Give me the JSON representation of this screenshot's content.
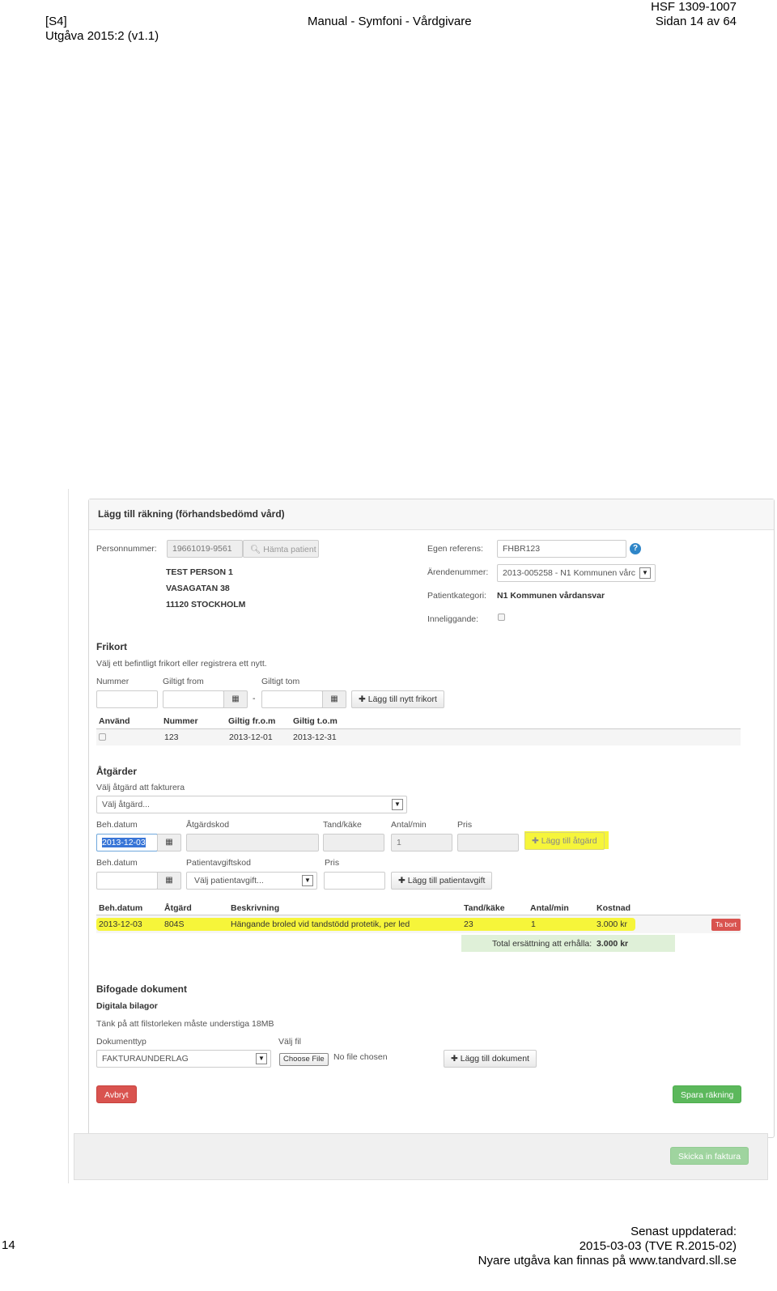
{
  "header": {
    "code": "[S4]",
    "edition": "Utgåva 2015:2 (v1.1)",
    "title": "Manual - Symfoni - Vårdgivare",
    "doc_id": "HSF 1309-1007",
    "page_of": "Sidan 14 av 64"
  },
  "footer": {
    "page_number": "14",
    "updated_label": "Senast uppdaterad:",
    "updated_value": "2015-03-03 (TVE R.2015-02)",
    "newer_note": "Nyare utgåva kan finnas på www.tandvard.sll.se"
  },
  "form": {
    "title": "Lägg till räkning (förhandsbedömd vård)",
    "patient": {
      "personnummer_label": "Personnummer:",
      "personnummer_value": "19661019-9561",
      "fetch_button": "Hämta patient",
      "name": "TEST PERSON 1",
      "street": "VASAGATAN 38",
      "city": "11120 STOCKHOLM"
    },
    "reference": {
      "egen_label": "Egen referens:",
      "egen_value": "FHBR123",
      "arende_label": "Ärendenummer:",
      "arende_value": "2013-005258 - N1 Kommunen vårc",
      "kategori_label": "Patientkategori:",
      "kategori_value": "N1 Kommunen vårdansvar",
      "inneliggande_label": "Inneliggande:"
    },
    "frikort": {
      "heading": "Frikort",
      "hint": "Välj ett befintligt frikort eller registrera ett nytt.",
      "nummer_label": "Nummer",
      "from_label": "Giltigt from",
      "tom_label": "Giltigt tom",
      "dash": "-",
      "add_button": "Lägg till nytt frikort",
      "table_headers": [
        "Använd",
        "Nummer",
        "Giltig fr.o.m",
        "Giltig t.o.m"
      ],
      "rows": [
        {
          "nummer": "123",
          "from": "2013-12-01",
          "tom": "2013-12-31"
        }
      ]
    },
    "atgarder": {
      "heading": "Åtgärder",
      "hint": "Välj åtgärd att fakturera",
      "select_placeholder": "Välj åtgärd...",
      "beh_datum_label": "Beh.datum",
      "atgardskod_label": "Åtgärdskod",
      "tand_label": "Tand/käke",
      "antal_label": "Antal/min",
      "pris_label": "Pris",
      "beh_datum_value": "2013-12-03",
      "antal_value": "1",
      "add_atgard_button": "Lägg till åtgärd",
      "beh_datum2_label": "Beh.datum",
      "avgiftskod_label": "Patientavgiftskod",
      "pris2_label": "Pris",
      "avgift_placeholder": "Välj patientavgift...",
      "add_avgift_button": "Lägg till patientavgift",
      "table_headers": [
        "Beh.datum",
        "Åtgärd",
        "Beskrivning",
        "Tand/käke",
        "Antal/min",
        "Kostnad"
      ],
      "rows": [
        {
          "datum": "2013-12-03",
          "atgard": "804S",
          "beskrivning": "Hängande broled vid tandstödd protetik, per led",
          "tand": "23",
          "antal": "1",
          "kostnad": "3.000 kr"
        }
      ],
      "remove_button": "Ta bort",
      "total_label": "Total ersättning att erhålla:",
      "total_value": "3.000 kr"
    },
    "bilagor": {
      "heading": "Bifogade dokument",
      "subheading": "Digitala bilagor",
      "hint": "Tänk på att filstorleken måste understiga 18MB",
      "doctype_label": "Dokumenttyp",
      "doctype_value": "FAKTURAUNDERLAG",
      "file_label": "Välj fil",
      "choose_file": "Choose File",
      "no_file": "No file chosen",
      "add_doc_button": "Lägg till dokument"
    },
    "actions": {
      "cancel": "Avbryt",
      "save": "Spara räkning",
      "send": "Skicka in faktura"
    }
  },
  "colors": {
    "highlight": "#f6f53a",
    "danger": "#d9534f",
    "success": "#5cb85c",
    "info": "#2f86c8"
  }
}
